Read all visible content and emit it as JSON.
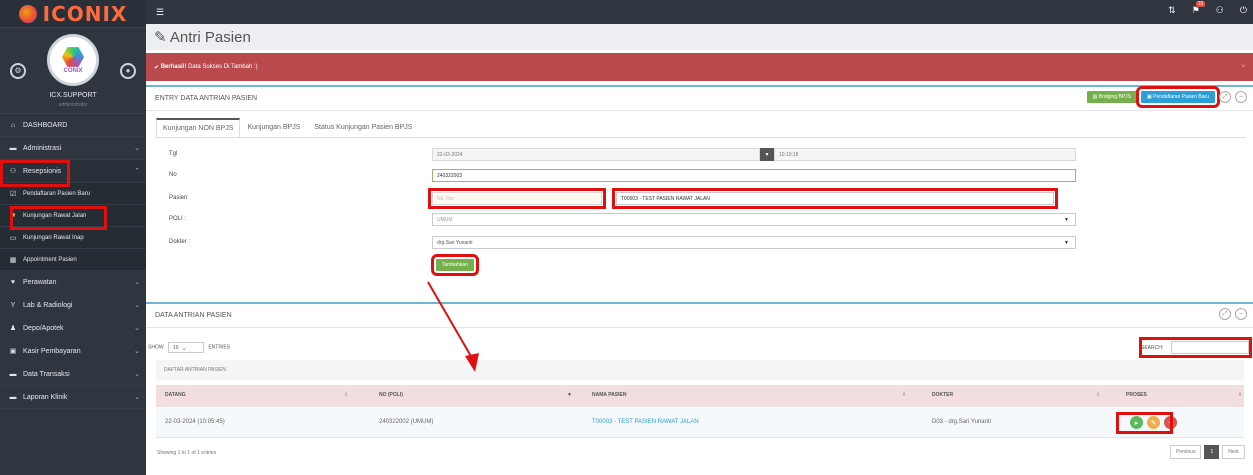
{
  "brand": {
    "logo_text": "ICONIX"
  },
  "profile": {
    "avatar_text": "CONIX",
    "user_name": "ICX.SUPPORT",
    "user_role": "administrator"
  },
  "sidebar": {
    "items": [
      {
        "label": "DASHBOARD",
        "icon": "home-icon"
      },
      {
        "label": "Administrasi",
        "icon": "card-icon"
      },
      {
        "label": "Resepsionis",
        "icon": "people-icon"
      },
      {
        "label": "Pendaftaran Pasien Baru",
        "icon": "check-icon"
      },
      {
        "label": "Kunjungan Rawat Jalan",
        "icon": "briefcase-icon"
      },
      {
        "label": "Kunjungan Rawat Inap",
        "icon": "bed-icon"
      },
      {
        "label": "Appointment Pasien",
        "icon": "calendar-icon"
      },
      {
        "label": "Perawatan",
        "icon": "heart-icon"
      },
      {
        "label": "Lab & Radiologi",
        "icon": "filter-icon"
      },
      {
        "label": "Depo/Apotek",
        "icon": "user-icon"
      },
      {
        "label": "Kasir Pembayaran",
        "icon": "money-icon"
      },
      {
        "label": "Data Transaksi",
        "icon": "list-icon"
      },
      {
        "label": "Laporan Klinik",
        "icon": "report-icon"
      }
    ]
  },
  "topbar": {
    "notif_count": "15"
  },
  "page": {
    "title": "Antri Pasien"
  },
  "alert": {
    "strong": "Berhasil!",
    "message": "Data Sukses Di Tambah :)",
    "close": "×"
  },
  "entry_panel": {
    "title": "ENTRY DATA ANTRIAN PASIEN",
    "bridging_label": "Bridging BPJS",
    "new_patient_label": "Pendaftaran Pasien Baru",
    "tabs": [
      "Kunjungan NON BPJS",
      "Kunjungan BPJS",
      "Status Kunjungan Pasien BPJS"
    ],
    "fields": {
      "tgl_label": "Tgl",
      "tgl_value": "22-03-2024",
      "time_value": "10:10:18",
      "no_label": "No",
      "no_value": "240322003",
      "pasien_label": "Pasien",
      "norm_placeholder": "No. Rm",
      "pasien_value": "T00003 - TEST PASIEN RAWAT JALAN",
      "poli_label": "POLI :",
      "poli_value": "UMUM",
      "dokter_label": "Dokter :",
      "dokter_value": "drg.Sari Yunanti"
    },
    "add_button": "Tambahkan"
  },
  "data_panel": {
    "title": "DATA ANTRIAN PASIEN",
    "show_label": "SHOW",
    "show_value": "10",
    "entries_label": "ENTRIES",
    "search_label": "SEARCH:",
    "caption": "DAFTAR ANTRIAN PASIEN",
    "columns": [
      "DATANG",
      "NO (POLI)",
      "NAMA PASIEN",
      "DOKTER",
      "PROSES"
    ],
    "rows": [
      {
        "datang": "22-03-2024 (10:05:45)",
        "no_poli": "240322002 (UMUM)",
        "nama": "T00003 - TEST PASIEN RAWAT JALAN",
        "dokter": "D03 - drg.Sari Yunanti"
      }
    ],
    "info": "Showing 1 to 1 of 1 entries",
    "pager": {
      "prev": "Previous",
      "page": "1",
      "next": "Next"
    }
  },
  "colors": {
    "highlight": "#e01010",
    "alert_bg": "#b9494c",
    "sidebar_bg": "#2f3640",
    "accent_blue": "#2d9fd8",
    "accent_green": "#76b04c"
  }
}
